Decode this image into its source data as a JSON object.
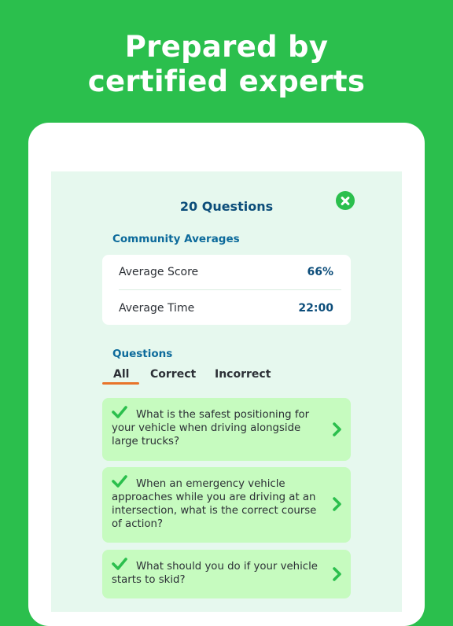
{
  "headline": {
    "line1": "Prepared by",
    "line2": "certified experts"
  },
  "modal": {
    "title": "20 Questions",
    "close_icon": "close-icon"
  },
  "community": {
    "title": "Community Averages",
    "rows": [
      {
        "label": "Average Score",
        "value": "66%"
      },
      {
        "label": "Average Time",
        "value": "22:00"
      }
    ]
  },
  "questions": {
    "title": "Questions",
    "tabs": [
      "All",
      "Correct",
      "Incorrect"
    ],
    "selected_tab": "All",
    "items": [
      {
        "text": "What is the safest positioning for your vehicle when driving alongside large trucks?",
        "status": "correct"
      },
      {
        "text": "When an emergency vehicle approaches while you are driving at an intersection, what is the correct course of action?",
        "status": "correct"
      },
      {
        "text": "What should you do if your vehicle starts to skid?",
        "status": "correct"
      }
    ]
  },
  "colors": {
    "background": "#2bbf4d",
    "accent_green": "#2bbf4d",
    "title_blue": "#0c4d7a",
    "tab_underline": "#e8742a",
    "card_green": "#c6fbbf"
  }
}
